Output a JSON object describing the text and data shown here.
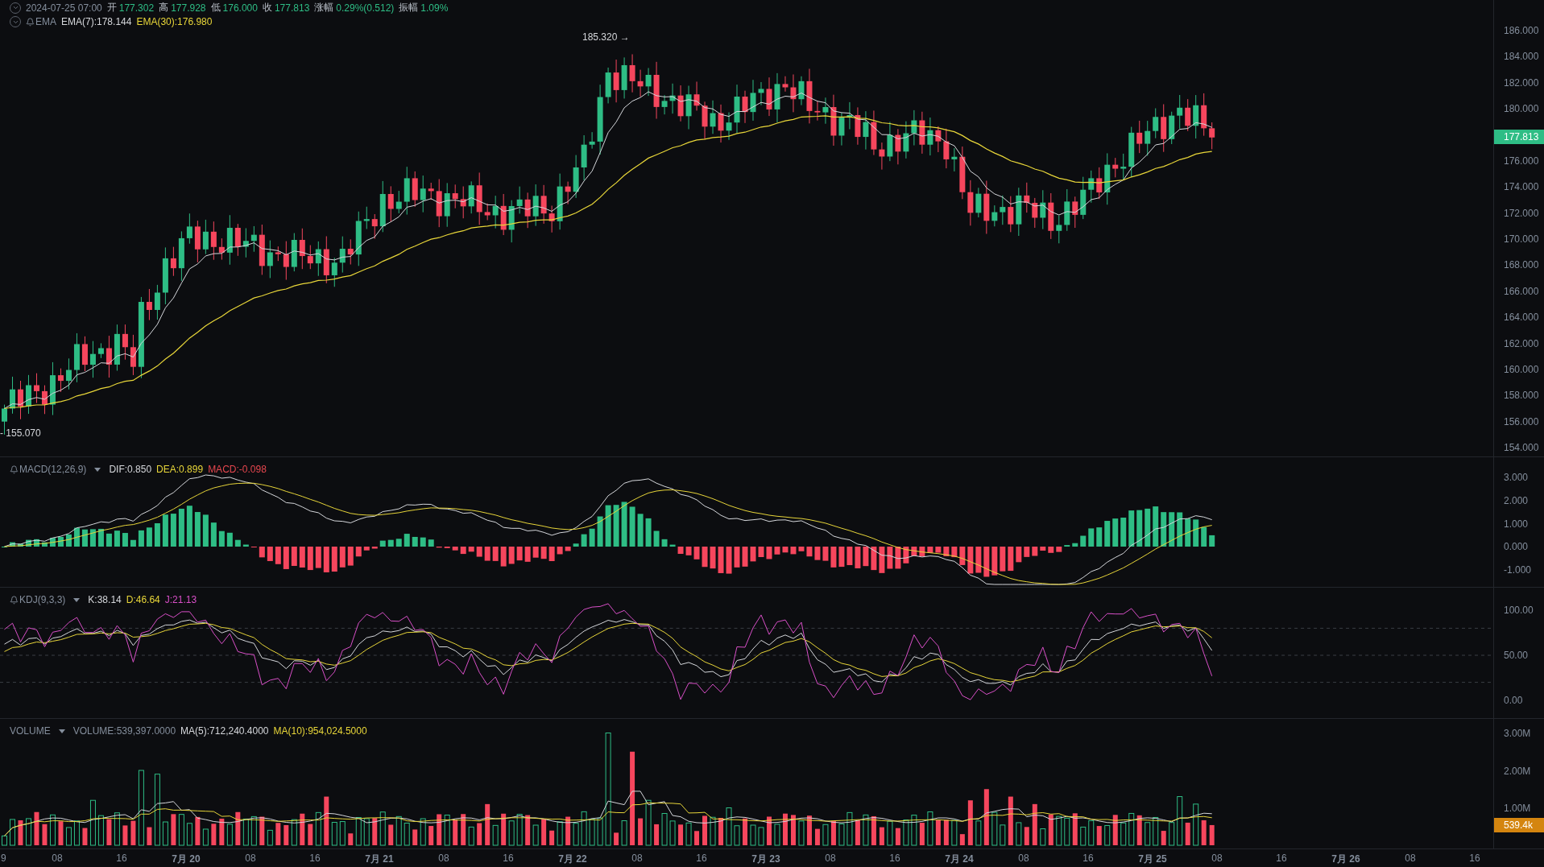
{
  "quote": {
    "datetime": "2024-07-25 07:00",
    "fields": [
      {
        "label": "开",
        "value": "177.302"
      },
      {
        "label": "高",
        "value": "177.928"
      },
      {
        "label": "低",
        "value": "176.000"
      },
      {
        "label": "收",
        "value": "177.813"
      },
      {
        "label": "涨幅",
        "value": "0.29%(0.512)"
      },
      {
        "label": "振幅",
        "value": "1.09%"
      }
    ]
  },
  "panels": [
    {
      "kind": "price",
      "legend": {
        "name": "EMA",
        "bell": true,
        "dropdown": false,
        "values": [
          {
            "text": "EMA(7):178.144",
            "color": "#d5d7db"
          },
          {
            "text": "EMA(30):176.980",
            "color": "#e8d639"
          }
        ]
      },
      "axis": [
        "186.000",
        "184.000",
        "182.000",
        "180.000",
        "176.000",
        "174.000",
        "172.000",
        "170.000",
        "168.000",
        "166.000",
        "164.000",
        "162.000",
        "160.000",
        "158.000",
        "156.000",
        "154.000"
      ],
      "price_tag": "177.813",
      "high_marker": "185.320 →",
      "low_marker": "- 155.070"
    },
    {
      "kind": "macd",
      "legend": {
        "name": "MACD(12,26,9)",
        "bell": true,
        "dropdown": true,
        "values": [
          {
            "text": "DIF:0.850",
            "color": "#d5d7db"
          },
          {
            "text": "DEA:0.899",
            "color": "#e8d639"
          },
          {
            "text": "MACD:-0.098",
            "color": "#e8474f"
          }
        ]
      },
      "axis": [
        "3.000",
        "2.000",
        "1.000",
        "0.000",
        "-1.000"
      ]
    },
    {
      "kind": "kdj",
      "legend": {
        "name": "KDJ(9,3,3)",
        "bell": true,
        "dropdown": true,
        "values": [
          {
            "text": "K:38.14",
            "color": "#d5d7db"
          },
          {
            "text": "D:46.64",
            "color": "#e8d639"
          },
          {
            "text": "J:21.13",
            "color": "#d94fc8"
          }
        ]
      },
      "axis": [
        "100.00",
        "50.00",
        "0.00"
      ]
    },
    {
      "kind": "volume",
      "legend": {
        "name": "VOLUME",
        "bell": false,
        "dropdown": true,
        "values": [
          {
            "text": "VOLUME:539,397.0000",
            "color": "#848e9c"
          },
          {
            "text": "MA(5):712,240.4000",
            "color": "#d5d7db"
          },
          {
            "text": "MA(10):954,024.5000",
            "color": "#e8d639"
          }
        ]
      },
      "axis": [
        "3.00M",
        "2.00M",
        "1.00M"
      ],
      "price_tag": "539.4k"
    }
  ],
  "time_axis": [
    {
      "label": "9",
      "kind": "hour"
    },
    {
      "label": "08",
      "kind": "hour"
    },
    {
      "label": "16",
      "kind": "hour"
    },
    {
      "label": "7月 20",
      "kind": "day"
    },
    {
      "label": "08",
      "kind": "hour"
    },
    {
      "label": "16",
      "kind": "hour"
    },
    {
      "label": "7月 21",
      "kind": "day"
    },
    {
      "label": "08",
      "kind": "hour"
    },
    {
      "label": "16",
      "kind": "hour"
    },
    {
      "label": "7月 22",
      "kind": "day"
    },
    {
      "label": "08",
      "kind": "hour"
    },
    {
      "label": "16",
      "kind": "hour"
    },
    {
      "label": "7月 23",
      "kind": "day"
    },
    {
      "label": "08",
      "kind": "hour"
    },
    {
      "label": "16",
      "kind": "hour"
    },
    {
      "label": "7月 24",
      "kind": "day"
    },
    {
      "label": "08",
      "kind": "hour"
    },
    {
      "label": "16",
      "kind": "hour"
    },
    {
      "label": "7月 25",
      "kind": "day"
    },
    {
      "label": "08",
      "kind": "hour"
    },
    {
      "label": "16",
      "kind": "hour"
    },
    {
      "label": "7月 26",
      "kind": "day"
    },
    {
      "label": "08",
      "kind": "hour"
    },
    {
      "label": "16",
      "kind": "hour"
    }
  ]
}
